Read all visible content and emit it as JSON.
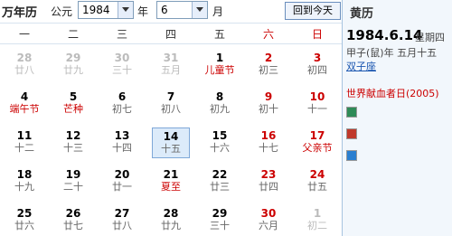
{
  "toolbar": {
    "title": "万年历",
    "era_label": "公元",
    "year_value": "1984",
    "year_suffix": "年",
    "month_value": "6",
    "month_suffix": "月",
    "today_button": "回到今天"
  },
  "weekdays": [
    "一",
    "二",
    "三",
    "四",
    "五",
    "六",
    "日"
  ],
  "weeks": [
    [
      {
        "day": "28",
        "lunar": "廿八",
        "other": true
      },
      {
        "day": "29",
        "lunar": "廿九",
        "other": true
      },
      {
        "day": "30",
        "lunar": "三十",
        "other": true
      },
      {
        "day": "31",
        "lunar": "五月",
        "other": true
      },
      {
        "day": "1",
        "lunar": "儿童节",
        "festival": true
      },
      {
        "day": "2",
        "lunar": "初三",
        "weekend": true
      },
      {
        "day": "3",
        "lunar": "初四",
        "weekend": true
      }
    ],
    [
      {
        "day": "4",
        "lunar": "端午节",
        "festival": true
      },
      {
        "day": "5",
        "lunar": "芒种",
        "festival": true
      },
      {
        "day": "6",
        "lunar": "初七"
      },
      {
        "day": "7",
        "lunar": "初八"
      },
      {
        "day": "8",
        "lunar": "初九"
      },
      {
        "day": "9",
        "lunar": "初十",
        "weekend": true
      },
      {
        "day": "10",
        "lunar": "十一",
        "weekend": true
      }
    ],
    [
      {
        "day": "11",
        "lunar": "十二"
      },
      {
        "day": "12",
        "lunar": "十三"
      },
      {
        "day": "13",
        "lunar": "十四"
      },
      {
        "day": "14",
        "lunar": "十五",
        "today": true
      },
      {
        "day": "15",
        "lunar": "十六"
      },
      {
        "day": "16",
        "lunar": "十七",
        "weekend": true
      },
      {
        "day": "17",
        "lunar": "父亲节",
        "weekend": true,
        "festival": true
      }
    ],
    [
      {
        "day": "18",
        "lunar": "十九"
      },
      {
        "day": "19",
        "lunar": "二十"
      },
      {
        "day": "20",
        "lunar": "廿一"
      },
      {
        "day": "21",
        "lunar": "夏至",
        "festival": true
      },
      {
        "day": "22",
        "lunar": "廿三"
      },
      {
        "day": "23",
        "lunar": "廿四",
        "weekend": true
      },
      {
        "day": "24",
        "lunar": "廿五",
        "weekend": true
      }
    ],
    [
      {
        "day": "25",
        "lunar": "廿六"
      },
      {
        "day": "26",
        "lunar": "廿七"
      },
      {
        "day": "27",
        "lunar": "廿八"
      },
      {
        "day": "28",
        "lunar": "廿九"
      },
      {
        "day": "29",
        "lunar": "三十"
      },
      {
        "day": "30",
        "lunar": "六月",
        "weekend": true
      },
      {
        "day": "1",
        "lunar": "初二",
        "other": true
      }
    ]
  ],
  "panel": {
    "title": "黄历",
    "date": "1984.6.14",
    "weekday": "星期四",
    "lunar": "甲子(鼠)年 五月十五",
    "zodiac": "双子座",
    "event": "世界献血者日(2005)",
    "tags": [
      {
        "name": "yi-icon",
        "color": "#2e8b57"
      },
      {
        "name": "ji-icon",
        "color": "#c0392b"
      },
      {
        "name": "chong-icon",
        "color": "#2b7fd0"
      }
    ]
  }
}
